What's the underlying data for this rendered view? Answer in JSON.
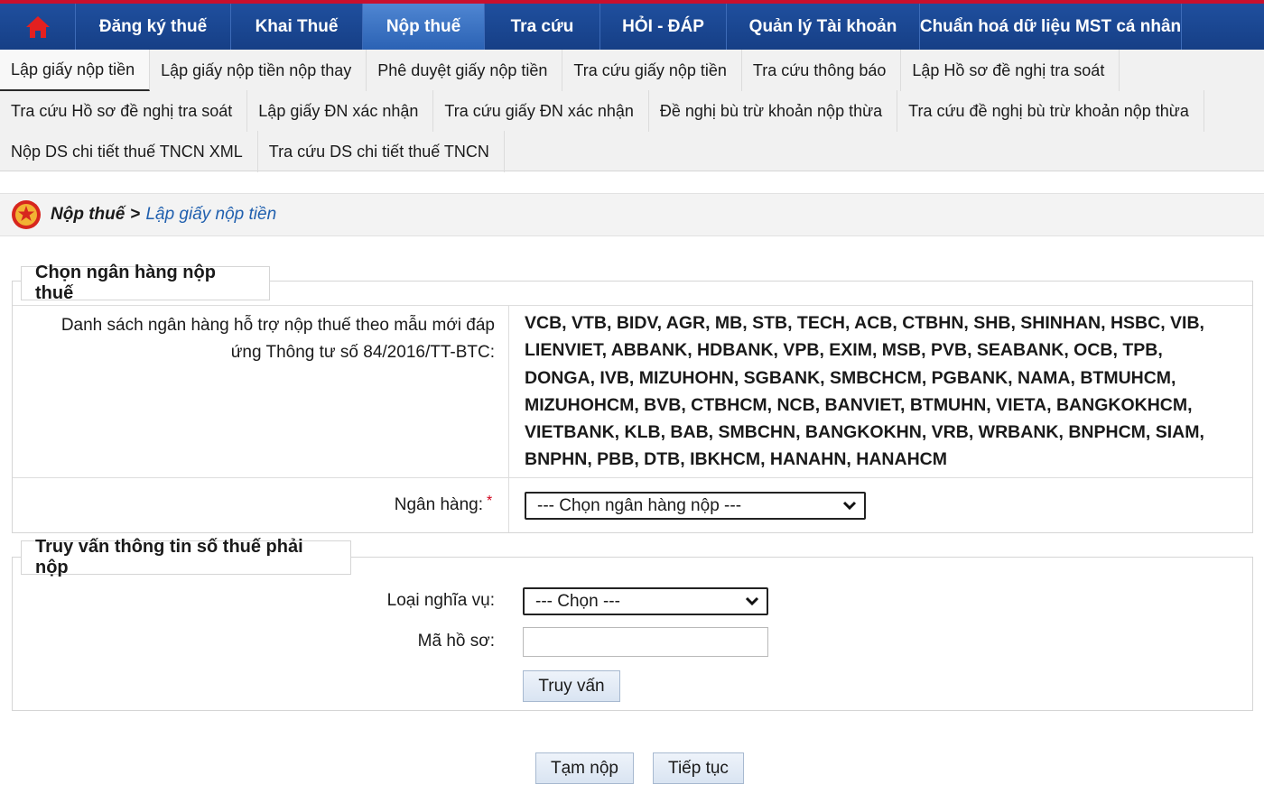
{
  "top_nav": {
    "home_icon": "home-icon",
    "items": [
      {
        "label": "Đăng ký thuế"
      },
      {
        "label": "Khai Thuế"
      },
      {
        "label": "Nộp thuế",
        "active": true
      },
      {
        "label": "Tra cứu"
      },
      {
        "label": "HỎI - ĐÁP"
      },
      {
        "label": "Quản lý Tài khoản"
      },
      {
        "label": "Chuẩn hoá dữ liệu MST cá nhân"
      }
    ],
    "colors": {
      "bar": "#1f4f9e",
      "active": "#4f86d2",
      "top_border": "#c8102e"
    }
  },
  "sub_menu": {
    "items": [
      "Lập giấy nộp tiền",
      "Lập giấy nộp tiền nộp thay",
      "Phê duyệt giấy nộp tiền",
      "Tra cứu giấy nộp tiền",
      "Tra cứu thông báo",
      "Lập Hồ sơ đề nghị tra soát",
      "Tra cứu Hồ sơ đề nghị tra soát",
      "Lập giấy ĐN xác nhận",
      "Tra cứu giấy ĐN xác nhận",
      "Đề nghị bù trừ khoản nộp thừa",
      "Tra cứu đề nghị bù trừ khoản nộp thừa",
      "Nộp DS chi tiết thuế TNCN XML",
      "Tra cứu DS chi tiết thuế TNCN"
    ],
    "active_index": 0
  },
  "breadcrumb": {
    "icon": "emblem-icon",
    "root": "Nộp thuế",
    "separator": ">",
    "current": "Lập giấy nộp tiền"
  },
  "section_bank": {
    "legend": "Chọn ngân hàng nộp thuế",
    "list_label": "Danh sách ngân hàng hỗ trợ nộp thuế theo mẫu mới đáp ứng Thông tư số 84/2016/TT-BTC:",
    "bank_list": "VCB, VTB, BIDV, AGR, MB, STB, TECH, ACB, CTBHN, SHB, SHINHAN, HSBC, VIB, LIENVIET, ABBANK, HDBANK, VPB, EXIM, MSB, PVB, SEABANK, OCB, TPB, DONGA, IVB, MIZUHOHN, SGBANK, SMBCHCM, PGBANK, NAMA, BTMUHCM, MIZUHOHCM, BVB, CTBHCM, NCB, BANVIET, BTMUHN, VIETA, BANGKOKHCM, VIETBANK, KLB, BAB, SMBCHN, BANGKOKHN, VRB, WRBANK, BNPHCM, SIAM, BNPHN, PBB, DTB, IBKHCM, HANAHN, HANAHCM",
    "bank_field_label": "Ngân hàng:",
    "required_mark": "*",
    "bank_select_value": "--- Chọn ngân hàng nộp ---"
  },
  "section_query": {
    "legend": "Truy vấn thông tin số thuế phải nộp",
    "obligation_label": "Loại nghĩa vụ:",
    "obligation_select_value": "--- Chọn ---",
    "record_label": "Mã hồ sơ:",
    "record_value": "",
    "query_button": "Truy vấn"
  },
  "actions": {
    "save_draft": "Tạm nộp",
    "continue": "Tiếp tục"
  }
}
